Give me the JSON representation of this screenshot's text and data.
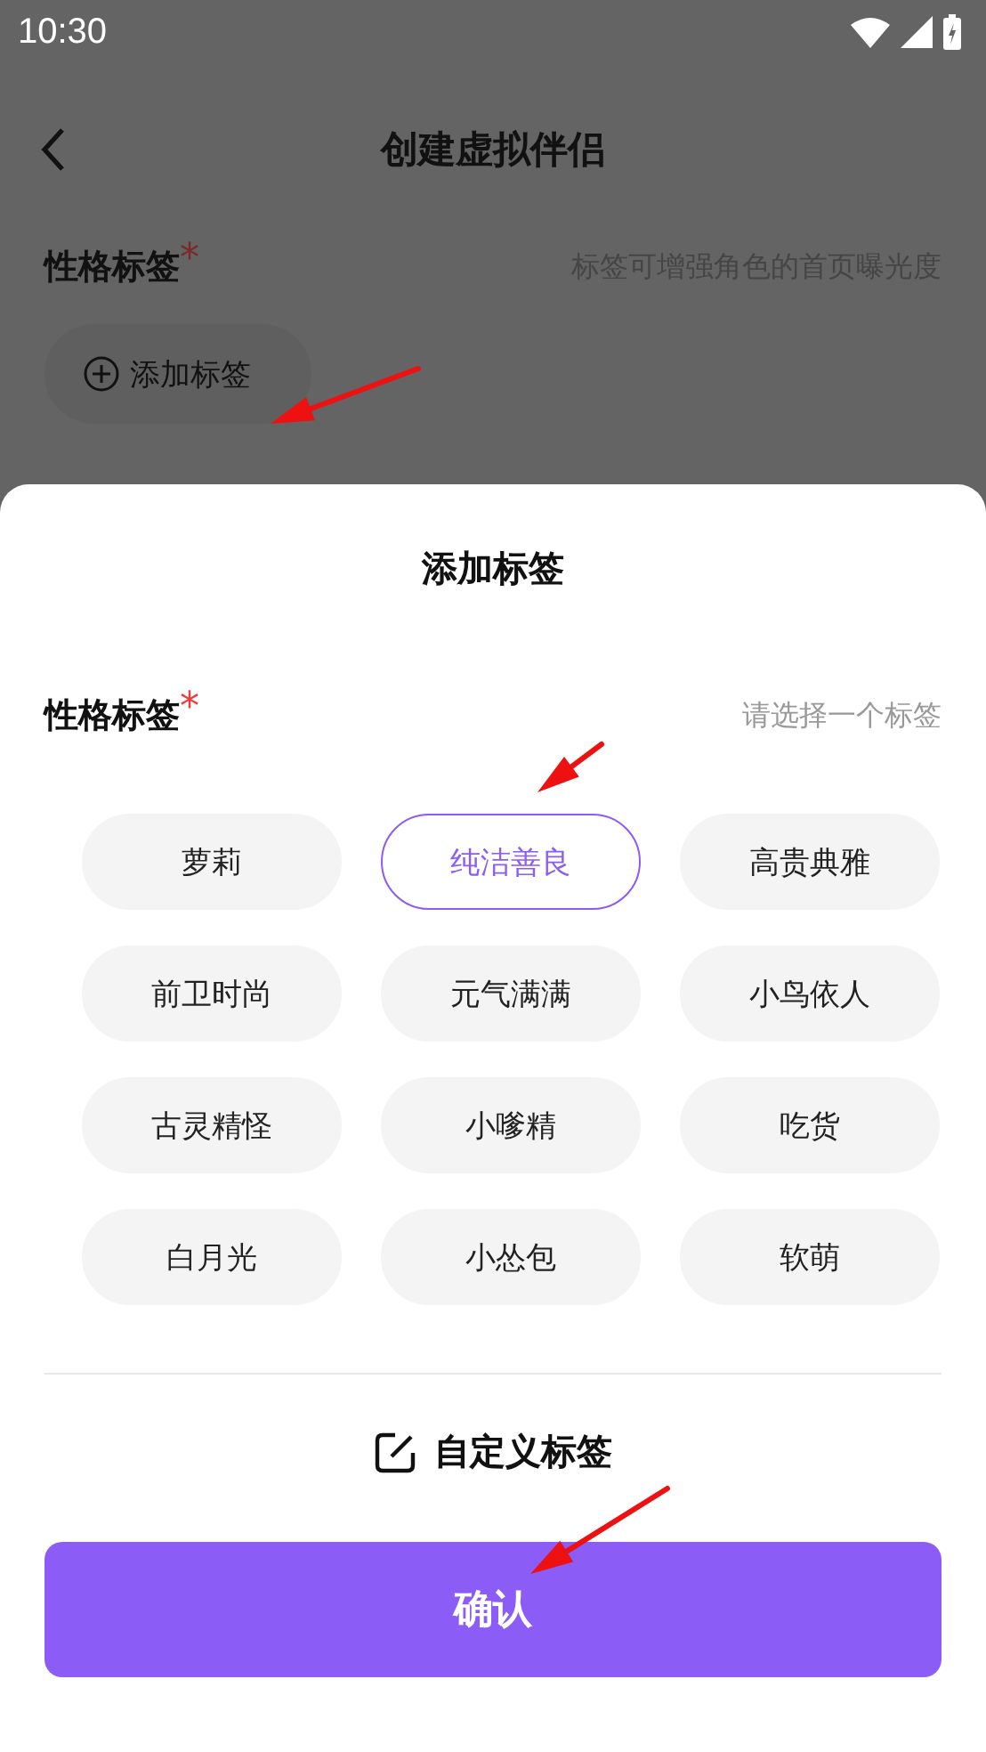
{
  "status_bar": {
    "time": "10:30"
  },
  "header": {
    "title": "创建虚拟伴侣"
  },
  "section": {
    "label": "性格标签",
    "required_mark": "*",
    "hint": "标签可增强角色的首页曝光度",
    "add_button": "添加标签"
  },
  "sheet": {
    "title": "添加标签",
    "label": "性格标签",
    "required_mark": "*",
    "hint": "请选择一个标签",
    "tags": [
      {
        "label": "萝莉",
        "selected": false
      },
      {
        "label": "纯洁善良",
        "selected": true
      },
      {
        "label": "高贵典雅",
        "selected": false
      },
      {
        "label": "前卫时尚",
        "selected": false
      },
      {
        "label": "元气满满",
        "selected": false
      },
      {
        "label": "小鸟依人",
        "selected": false
      },
      {
        "label": "古灵精怪",
        "selected": false
      },
      {
        "label": "小嗲精",
        "selected": false
      },
      {
        "label": "吃货",
        "selected": false
      },
      {
        "label": "白月光",
        "selected": false
      },
      {
        "label": "小怂包",
        "selected": false
      },
      {
        "label": "软萌",
        "selected": false
      }
    ],
    "custom_button": "自定义标签",
    "confirm_button": "确认"
  }
}
